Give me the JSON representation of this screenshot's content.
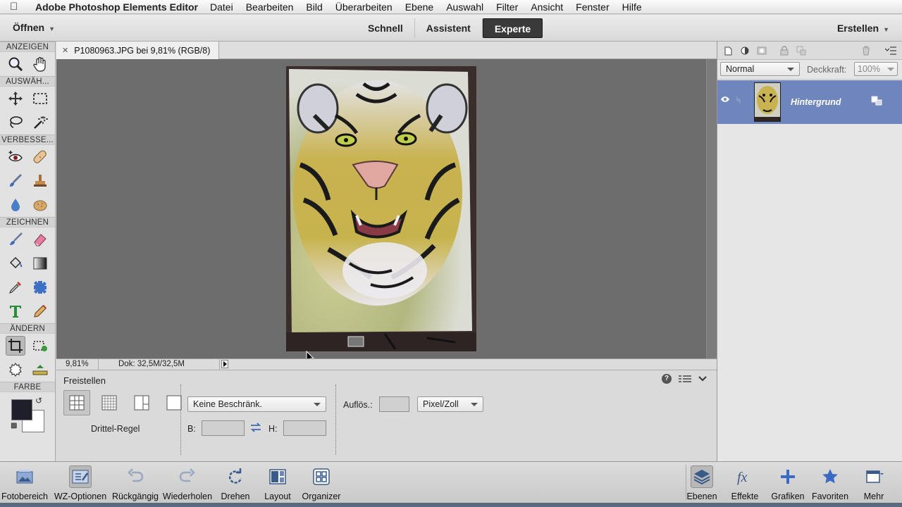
{
  "menubar": {
    "app_name": "Adobe Photoshop Elements Editor",
    "items": [
      "Datei",
      "Bearbeiten",
      "Bild",
      "Überarbeiten",
      "Ebene",
      "Auswahl",
      "Filter",
      "Ansicht",
      "Fenster",
      "Hilfe"
    ]
  },
  "header": {
    "open_label": "Öffnen",
    "modes": [
      "Schnell",
      "Assistent",
      "Experte"
    ],
    "active_mode": "Experte",
    "create_label": "Erstellen"
  },
  "toolbox": {
    "sections": {
      "view": "ANZEIGEN",
      "select": "AUSWÄH...",
      "enhance": "VERBESSE...",
      "draw": "ZEICHNEN",
      "modify": "ÄNDERN",
      "color": "FARBE"
    },
    "foreground_color": "#1f1f2b",
    "background_color": "#ffffff"
  },
  "document": {
    "tab_title": "P1080963.JPG bei 9,81% (RGB/8)",
    "zoom": "9,81%",
    "doc_size": "Dok: 32,5M/32,5M"
  },
  "tool_options": {
    "title": "Freistellen",
    "overlay_label": "Drittel-Regel",
    "ratio_select": "Keine Beschränk.",
    "width_label": "B:",
    "height_label": "H:",
    "resolution_label": "Auflös.:",
    "unit_select": "Pixel/Zoll",
    "width_value": "",
    "height_value": "",
    "resolution_value": ""
  },
  "layers_panel": {
    "blend_mode": "Normal",
    "opacity_label": "Deckkraft:",
    "opacity_value": "100%",
    "layer_name": "Hintergrund"
  },
  "bottom_bar": {
    "left": [
      "Fotobereich",
      "WZ-Optionen",
      "Rückgängig",
      "Wiederholen",
      "Drehen",
      "Layout",
      "Organizer"
    ],
    "right": [
      "Ebenen",
      "Effekte",
      "Grafiken",
      "Favoriten",
      "Mehr"
    ]
  },
  "colors": {
    "accent_layer": "#6f86bd",
    "active_mode_bg": "#3a3a3a",
    "canvas_bg": "#6d6d6d"
  }
}
